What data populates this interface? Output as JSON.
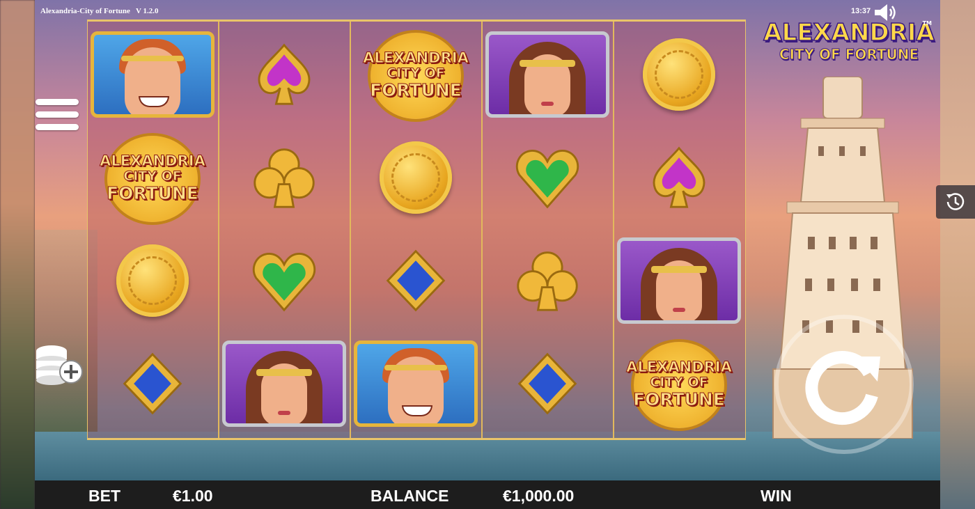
{
  "header": {
    "title": "Alexandria-City of Fortune",
    "version": "V 1.2.0",
    "clock": "13:37"
  },
  "branding": {
    "line1": "ALEXANDRIA",
    "line2": "CITY OF FORTUNE",
    "trademark": "TM"
  },
  "reels": {
    "logo_symbol": {
      "line1": "ALEXANDRIA",
      "line2": "CITY OF",
      "line3": "FORTUNE"
    },
    "grid": [
      [
        "hero",
        "logo",
        "coin",
        "diamond"
      ],
      [
        "spade",
        "club",
        "heart",
        "queen"
      ],
      [
        "logo",
        "coin",
        "diamond",
        "hero"
      ],
      [
        "queen",
        "heart",
        "club",
        "diamond"
      ],
      [
        "coin",
        "spade",
        "queen",
        "logo"
      ]
    ],
    "colors": {
      "spade": "#c234c8",
      "club": "#f0b83a",
      "heart": "#2fb64a",
      "diamond": "#2a54d0",
      "frame_gold": "#e6b53c"
    }
  },
  "controls": {
    "menu_icon": "hamburger-icon",
    "coins_icon": "coin-stack-plus-icon",
    "history_icon": "clock-history-icon",
    "spin_icon": "spin-arrow-icon",
    "sound_icon": "speaker-icon"
  },
  "bottom_bar": {
    "bet_label": "BET",
    "bet_value": "€1.00",
    "balance_label": "BALANCE",
    "balance_value": "€1,000.00",
    "win_label": "WIN"
  }
}
